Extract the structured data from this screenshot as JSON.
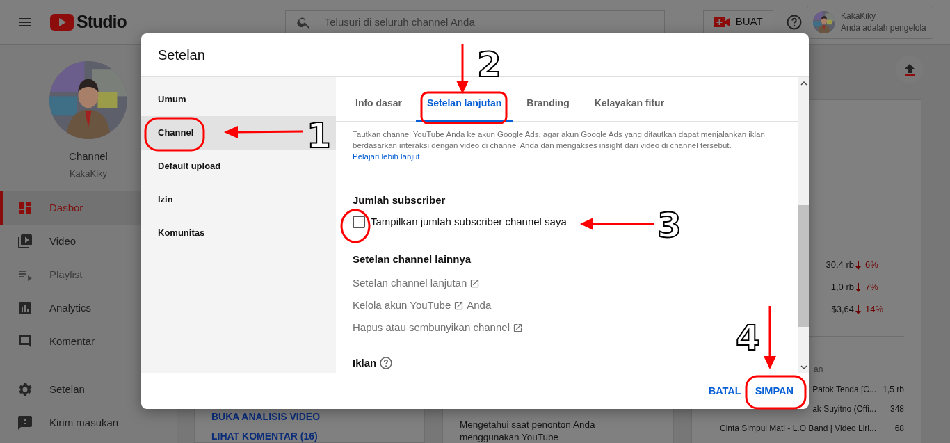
{
  "topbar": {
    "logo_text": "Studio",
    "search": {
      "placeholder": "Telusuri di seluruh channel Anda"
    },
    "create_button": "BUAT",
    "account": {
      "name": "KakaKiky",
      "role": "Anda adalah pengelola"
    }
  },
  "sidebar": {
    "channel_title": "Channel",
    "channel_name": "KakaKiky",
    "items": [
      {
        "label": "Dasbor",
        "selected": true,
        "disabled": false
      },
      {
        "label": "Video",
        "selected": false,
        "disabled": false
      },
      {
        "label": "Playlist",
        "selected": false,
        "disabled": true
      },
      {
        "label": "Analytics",
        "selected": false,
        "disabled": false
      },
      {
        "label": "Komentar",
        "selected": false,
        "disabled": false
      }
    ],
    "bottom_items": [
      {
        "label": "Setelan"
      },
      {
        "label": "Kirim masukan"
      }
    ]
  },
  "cards": {
    "left_links": [
      "BUKA ANALISIS VIDEO",
      "LIHAT KOMENTAR (16)"
    ],
    "middle_text": "Mengetahui saat penonton Anda menggunakan YouTube",
    "metrics": [
      {
        "value": "30,4 rb",
        "change": "6%"
      },
      {
        "value": "1,0 rb",
        "change": "7%"
      },
      {
        "value": "$3,64",
        "change": "14%"
      }
    ],
    "section_label": "an",
    "videos": [
      {
        "title": "Patok Tenda [C...",
        "views": "1,5 rb"
      },
      {
        "title": "ak Suyitno (Offi...",
        "views": "348"
      },
      {
        "title": "Cinta Simpul Mati - L.O Band | Video Liri...",
        "views": "68"
      }
    ]
  },
  "dialog": {
    "title": "Setelan",
    "nav": [
      {
        "label": "Umum",
        "selected": false
      },
      {
        "label": "Channel",
        "selected": true
      },
      {
        "label": "Default upload",
        "selected": false
      },
      {
        "label": "Izin",
        "selected": false
      },
      {
        "label": "Komunitas",
        "selected": false
      }
    ],
    "tabs": [
      {
        "label": "Info dasar",
        "selected": false
      },
      {
        "label": "Setelan lanjutan",
        "selected": true
      },
      {
        "label": "Branding",
        "selected": false
      },
      {
        "label": "Kelayakan fitur",
        "selected": false
      }
    ],
    "description": "Tautkan channel YouTube Anda ke akun Google Ads, agar akun Google Ads yang ditautkan dapat menjalankan iklan berdasarkan interaksi dengan video di channel Anda dan mengakses insight dari video di channel tersebut.",
    "learn_more": "Pelajari lebih lanjut",
    "subscriber_heading": "Jumlah subscriber",
    "subscriber_checkbox": {
      "label": "Tampilkan jumlah subscriber channel saya",
      "checked": false
    },
    "other_heading": "Setelan channel lainnya",
    "other_links": [
      {
        "text": "Setelan channel lanjutan"
      },
      {
        "text": "Kelola akun YouTube",
        "suffix": "Anda"
      },
      {
        "text": "Hapus atau sembunyikan channel"
      }
    ],
    "ads_heading": "Iklan",
    "buttons": [
      {
        "label": "BATAL"
      },
      {
        "label": "SIMPAN"
      }
    ]
  },
  "annotations": {
    "step_numbers": [
      "1",
      "2",
      "3",
      "4"
    ]
  }
}
